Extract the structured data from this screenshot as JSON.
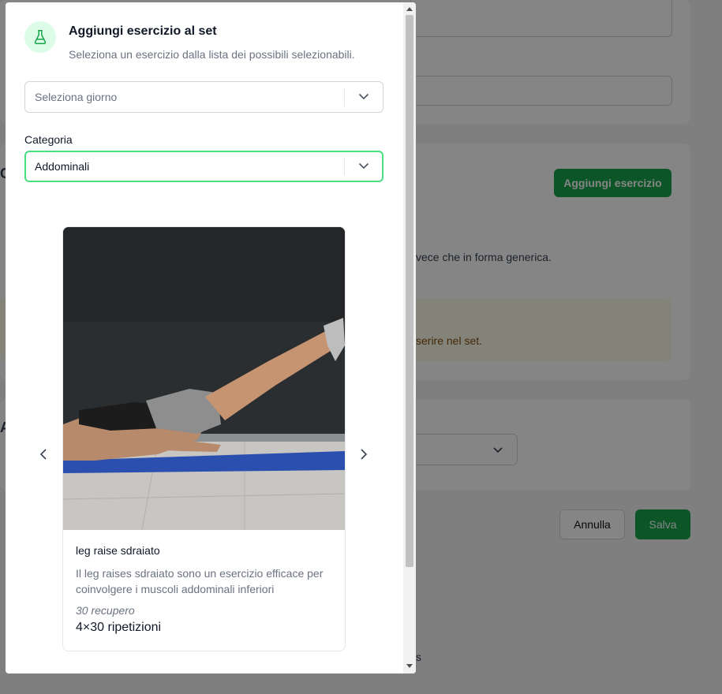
{
  "background": {
    "add_exercise_button": "Aggiungi esercizio",
    "partial_text_1": "vece che in forma generica.",
    "partial_text_2": "serire nel set.",
    "partial_text_3": "s",
    "partial_left_c": "C",
    "partial_left_a": "A",
    "cancel_button": "Annulla",
    "save_button": "Salva"
  },
  "modal": {
    "icon": "flask-icon",
    "title": "Aggiungi esercizio al set",
    "subtitle": "Seleziona un esercizio dalla lista dei possibili selezionabili.",
    "day_select": {
      "placeholder": "Seleziona giorno"
    },
    "category_label": "Categoria",
    "category_select": {
      "value": "Addominali"
    },
    "exercise": {
      "name": "leg raise sdraiato",
      "description": "Il leg raises sdraiato sono un esercizio efficace per coinvolgere i muscoli addominali inferiori",
      "rest": "30 recupero",
      "reps": "4×30 ripetizioni"
    },
    "prev_icon": "chevron-left-icon",
    "next_icon": "chevron-right-icon"
  },
  "colors": {
    "accent": "#16a34a",
    "focus_border": "#4ade80",
    "icon_bg": "#dcfce7"
  }
}
